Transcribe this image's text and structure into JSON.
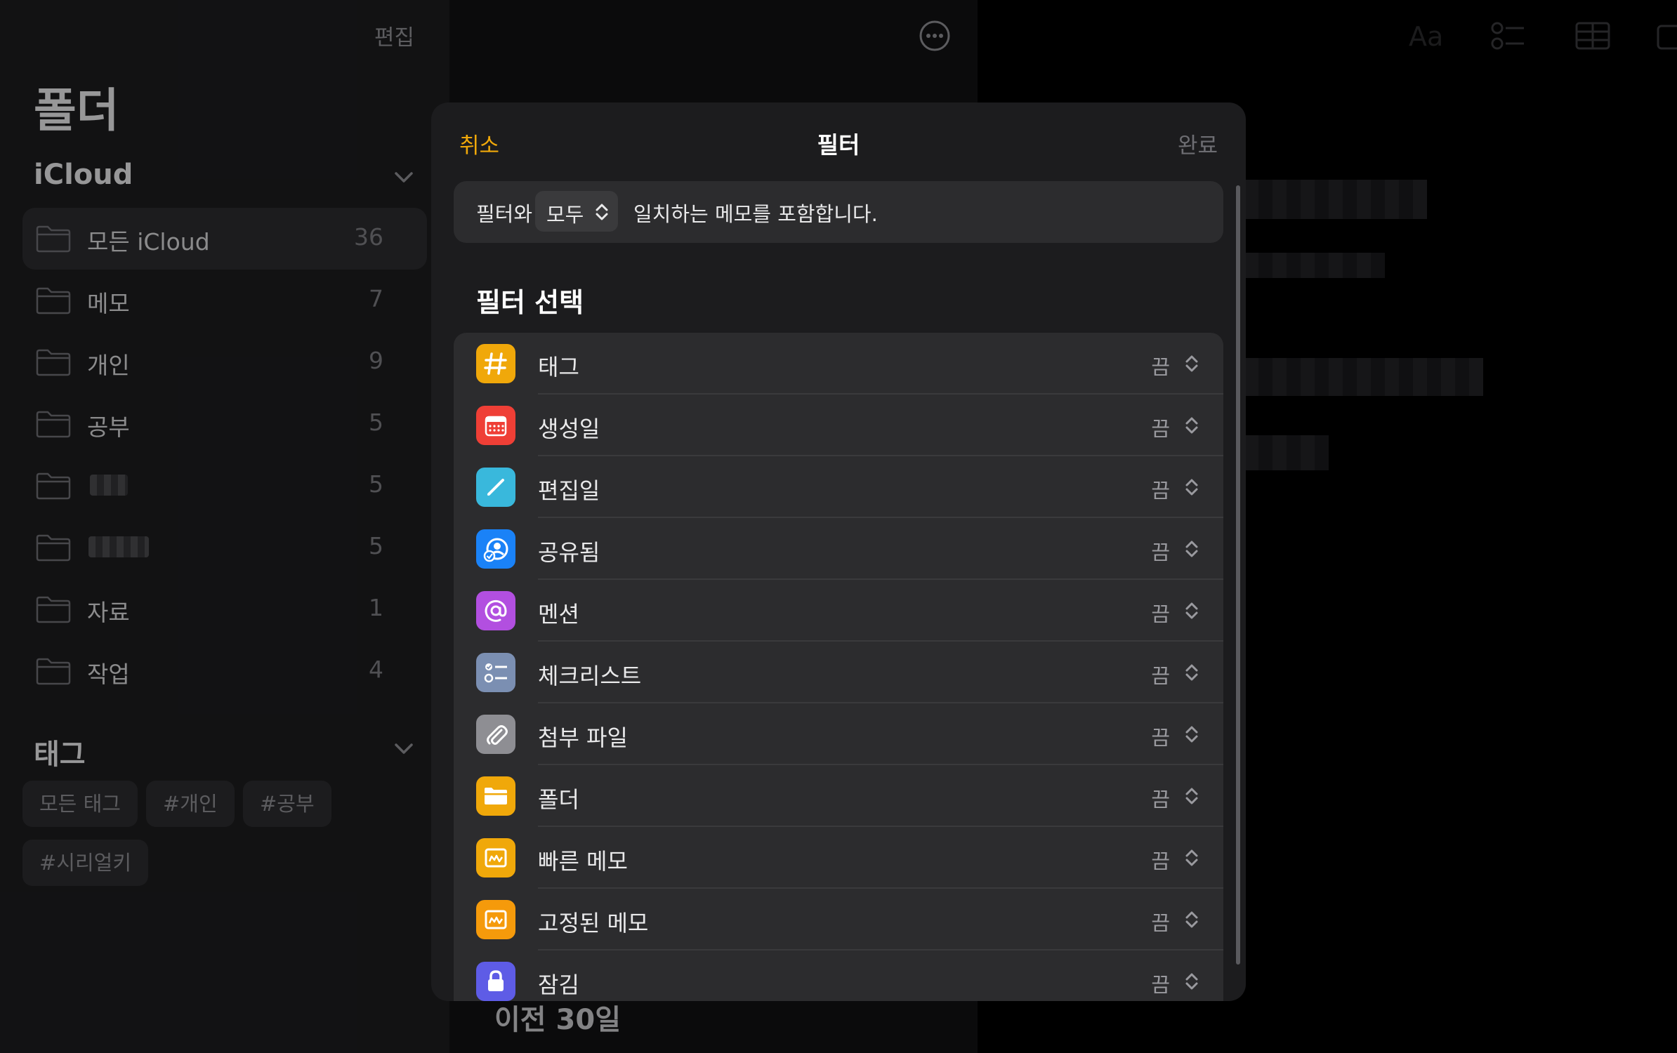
{
  "sidebar": {
    "edit_label": "편집",
    "title": "폴더",
    "icloud_header": "iCloud",
    "folders": [
      {
        "name": "모든 iCloud",
        "count": "36"
      },
      {
        "name": "메모",
        "count": "7"
      },
      {
        "name": "개인",
        "count": "9"
      },
      {
        "name": "공부",
        "count": "5"
      },
      {
        "name": "",
        "count": "5"
      },
      {
        "name": "",
        "count": "5"
      },
      {
        "name": "자료",
        "count": "1"
      },
      {
        "name": "작업",
        "count": "4"
      }
    ],
    "tags_header": "태그",
    "tags": [
      "모든 태그",
      "#개인",
      "#공부",
      "#시리얼키"
    ]
  },
  "background": {
    "previous_section": "이전 30일",
    "toolbar_format_label": "Aa"
  },
  "filter_sheet": {
    "cancel_label": "취소",
    "title": "필터",
    "done_label": "완료",
    "match_prefix": "필터와",
    "match_value": "모두",
    "match_suffix": "일치하는 메모를 포함합니다.",
    "section_title": "필터 선택",
    "filters": [
      {
        "label": "태그",
        "state": "끔",
        "icon": "hashtag-icon",
        "color": "#f0a80a"
      },
      {
        "label": "생성일",
        "state": "끔",
        "icon": "calendar-icon",
        "color": "#ef3f36"
      },
      {
        "label": "편집일",
        "state": "끔",
        "icon": "pencil-icon",
        "color": "#39b8dc"
      },
      {
        "label": "공유됨",
        "state": "끔",
        "icon": "shared-person-icon",
        "color": "#1a82f7"
      },
      {
        "label": "멘션",
        "state": "끔",
        "icon": "at-sign-icon",
        "color": "#b24fe0"
      },
      {
        "label": "체크리스트",
        "state": "끔",
        "icon": "checklist-icon",
        "color": "#7b8fb2"
      },
      {
        "label": "첨부 파일",
        "state": "끔",
        "icon": "paperclip-icon",
        "color": "#8e8e93"
      },
      {
        "label": "폴더",
        "state": "끔",
        "icon": "folder-icon",
        "color": "#f0a80a"
      },
      {
        "label": "빠른 메모",
        "state": "끔",
        "icon": "quick-note-icon",
        "color": "#f0a80a"
      },
      {
        "label": "고정된 메모",
        "state": "끔",
        "icon": "pinned-note-icon",
        "color": "#f59a0b"
      },
      {
        "label": "잠김",
        "state": "끔",
        "icon": "lock-icon",
        "color": "#5e5ce6"
      }
    ]
  }
}
